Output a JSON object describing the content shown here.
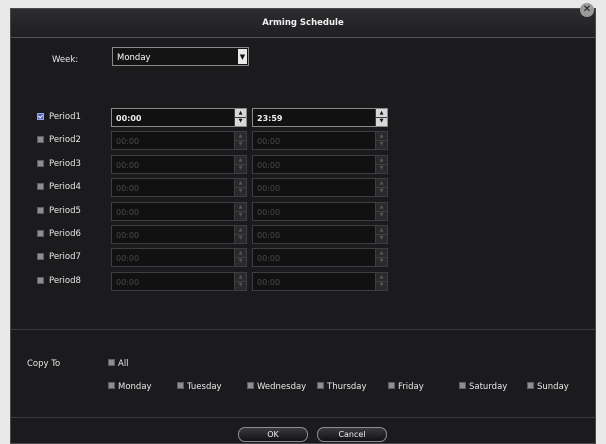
{
  "dialog": {
    "title": "Arming Schedule",
    "close_icon": "close-icon"
  },
  "week": {
    "label": "Week:",
    "selected": "Monday",
    "dropdown_icon": "chevron-down-icon"
  },
  "periods": [
    {
      "label": "Period1",
      "checked": true,
      "start": "00:00",
      "end": "23:59"
    },
    {
      "label": "Period2",
      "checked": false,
      "start": "00:00",
      "end": "00:00"
    },
    {
      "label": "Period3",
      "checked": false,
      "start": "00:00",
      "end": "00:00"
    },
    {
      "label": "Period4",
      "checked": false,
      "start": "00:00",
      "end": "00:00"
    },
    {
      "label": "Period5",
      "checked": false,
      "start": "00:00",
      "end": "00:00"
    },
    {
      "label": "Period6",
      "checked": false,
      "start": "00:00",
      "end": "00:00"
    },
    {
      "label": "Period7",
      "checked": false,
      "start": "00:00",
      "end": "00:00"
    },
    {
      "label": "Period8",
      "checked": false,
      "start": "00:00",
      "end": "00:00"
    }
  ],
  "copy_to": {
    "label": "Copy To",
    "all_label": "All",
    "days": [
      "Monday",
      "Tuesday",
      "Wednesday",
      "Thursday",
      "Friday",
      "Saturday",
      "Sunday"
    ]
  },
  "buttons": {
    "ok": "OK",
    "cancel": "Cancel"
  },
  "colors": {
    "background": "#1b1b1d",
    "checkbox_checked": "#4f5fc7",
    "checkbox_unchecked": "#8d8d95"
  }
}
